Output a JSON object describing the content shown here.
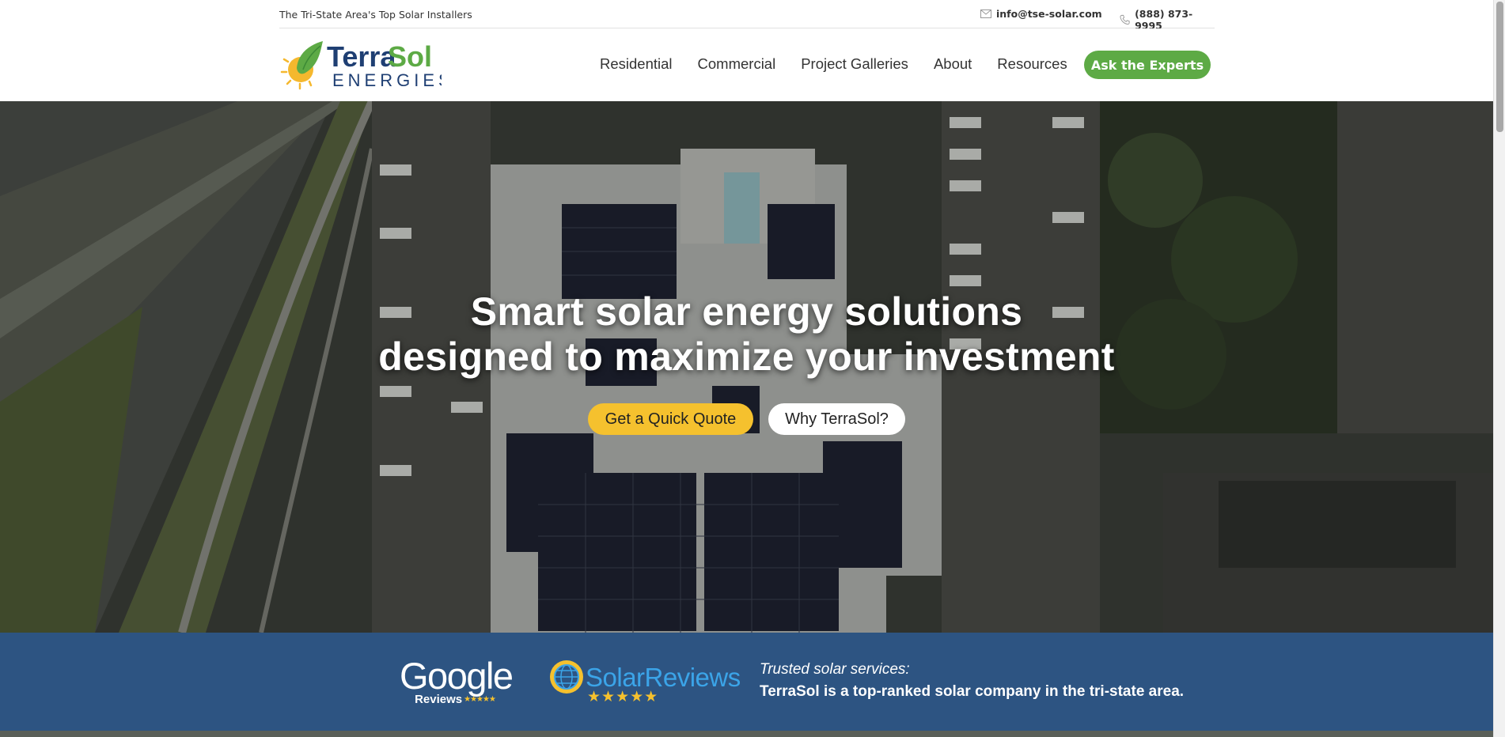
{
  "topbar": {
    "tagline": "The Tri-State Area's Top Solar Installers",
    "email": "info@tse-solar.com",
    "phone": "(888) 873-9995"
  },
  "logo": {
    "word_terra": "Terra",
    "word_sol": "Sol",
    "word_energies": "ENERGIES"
  },
  "nav": {
    "items": [
      "Residential",
      "Commercial",
      "Project Galleries",
      "About",
      "Resources"
    ],
    "cta": "Ask the Experts"
  },
  "hero": {
    "headline_line1": "Smart solar energy solutions",
    "headline_line2": "designed to maximize your investment",
    "quote_button": "Get a Quick Quote",
    "why_button": "Why TerraSol?"
  },
  "trust": {
    "google_word": "Google",
    "google_sub": "Reviews",
    "google_stars": "★★★★★",
    "solarreviews_word": "SolarReviews",
    "solarreviews_stars": "★★★★★",
    "solarreviews_rating": 4.5,
    "line1": "Trusted solar services:",
    "line2": "TerraSol is a top-ranked solar company in the tri-state area."
  },
  "colors": {
    "brand_green": "#5daa45",
    "brand_navy": "#1f3f73",
    "accent_yellow": "#f5c12e",
    "trust_band": "#2d5482"
  }
}
